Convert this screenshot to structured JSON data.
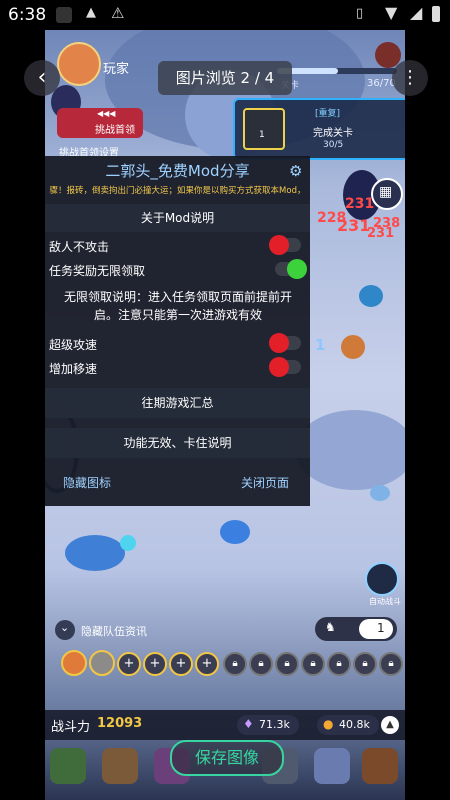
{
  "status_bar": {
    "time": "6:38"
  },
  "viewer": {
    "title": "图片浏览 2 / 4",
    "back_glyph": "‹",
    "more_glyph": "⋮"
  },
  "player": {
    "name": "玩家",
    "challenge_label": "挑战首领",
    "challenge_arrows": "◀◀◀",
    "partial_label": "挑战首领设置"
  },
  "stage": {
    "progress_text": "36/70",
    "level_label": "关卡",
    "progress_fraction": 0.51
  },
  "quest": {
    "repeat_tag": "[重复]",
    "title": "完成关卡",
    "progress": "30/5",
    "item_count": "1"
  },
  "mod_menu": {
    "title": "二郭头_免费Mod分享",
    "marquee": "骤！报砖，倒卖拘出门必撞大运；如果你是以购买方式获取本Mod，",
    "about_label": "关于Mod说明",
    "options": [
      {
        "label": "敌人不攻击",
        "on": false
      },
      {
        "label": "任务奖励无限领取",
        "on": true
      }
    ],
    "note": "无限领取说明：进入任务领取页面前提前开启。注意只能第一次进游戏有效",
    "options2": [
      {
        "label": "超级攻速",
        "on": false
      },
      {
        "label": "增加移速",
        "on": false
      }
    ],
    "summary_label": "往期游戏汇总",
    "invalid_label": "功能无效、卡住说明",
    "hide_icon_label": "隐藏图标",
    "close_page_label": "关闭页面"
  },
  "damage_numbers": [
    "231",
    "228",
    "231",
    "238",
    "231"
  ],
  "hit_number": "1",
  "team": {
    "hide_info_label": "隐藏队伍资讯",
    "speed_value": "1",
    "auto_label": "自动战斗"
  },
  "bottom_bar": {
    "power_label": "战斗力",
    "power_value": "12093",
    "gems": "71.3k",
    "coins": "40.8k",
    "save_button": "保存图像"
  },
  "colors": {
    "toggle_on": "#3cd23c",
    "toggle_off": "#e3202a",
    "accent": "#9fd2ff",
    "power": "#f2c744"
  }
}
